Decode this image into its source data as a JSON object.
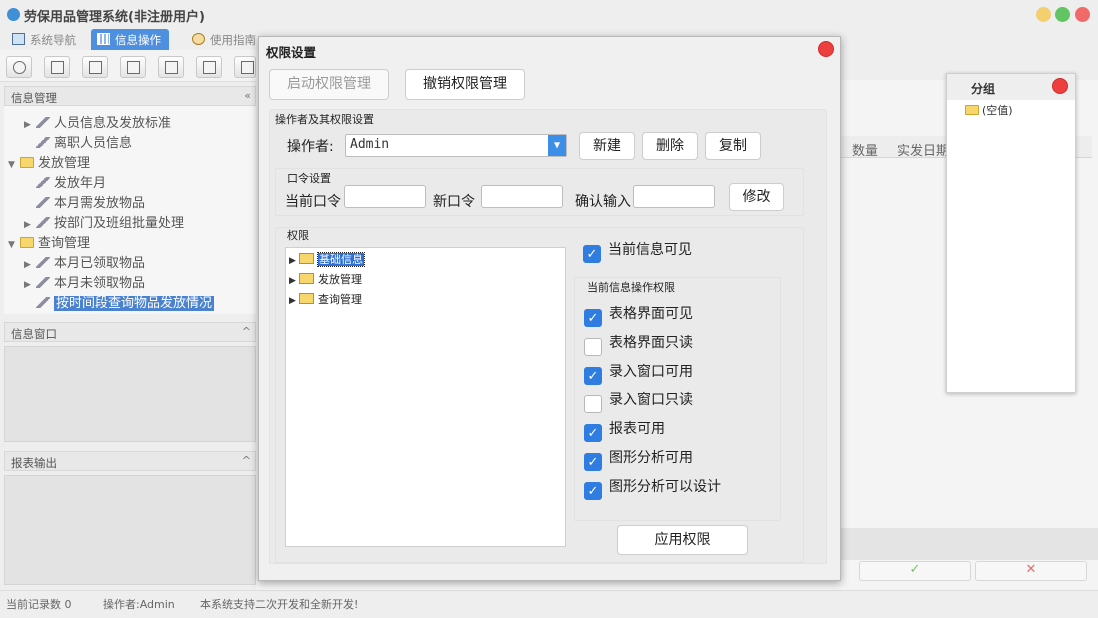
{
  "app": {
    "title": "劳保用品管理系统(非注册用户)"
  },
  "tabs": [
    {
      "label": "系统导航"
    },
    {
      "label": "信息操作"
    },
    {
      "label": "使用指南"
    }
  ],
  "left": {
    "panel_title": "信息管理",
    "tree": [
      {
        "label": "人员信息及发放标准"
      },
      {
        "label": "离职人员信息"
      },
      {
        "label": "发放管理"
      },
      {
        "label": "发放年月"
      },
      {
        "label": "本月需发放物品"
      },
      {
        "label": "按部门及班组批量处理"
      },
      {
        "label": "查询管理"
      },
      {
        "label": "本月已领取物品"
      },
      {
        "label": "本月未领取物品"
      },
      {
        "label": "按时间段查询物品发放情况"
      }
    ],
    "info_window_title": "信息窗口",
    "report_title": "报表输出"
  },
  "grid": {
    "headers": [
      "数量",
      "实发日期"
    ]
  },
  "bottom": {
    "ok_symbol": "✓",
    "cancel_symbol": "✕"
  },
  "status": {
    "records": "当前记录数 0",
    "operator": "操作者:Admin",
    "note": "本系统支持二次开发和全新开发!"
  },
  "group_panel": {
    "title": "分组",
    "item": "(空值)"
  },
  "dialog": {
    "title": "权限设置",
    "btn_start": "启动权限管理",
    "btn_revoke": "撤销权限管理",
    "operator_section": "操作者及其权限设置",
    "operator_label": "操作者:",
    "operator_value": "Admin",
    "btn_new": "新建",
    "btn_delete": "删除",
    "btn_copy": "复制",
    "password_section": "口令设置",
    "current_pwd": "当前口令",
    "new_pwd": "新口令",
    "confirm_pwd": "确认输入",
    "btn_modify": "修改",
    "perm_section": "权限",
    "perm_tree": [
      {
        "label": "基础信息"
      },
      {
        "label": "发放管理"
      },
      {
        "label": "查询管理"
      }
    ],
    "current_visible": "当前信息可见",
    "ops_section": "当前信息操作权限",
    "ops": [
      {
        "label": "表格界面可见",
        "checked": true
      },
      {
        "label": "表格界面只读",
        "checked": false
      },
      {
        "label": "录入窗口可用",
        "checked": true
      },
      {
        "label": "录入窗口只读",
        "checked": false
      },
      {
        "label": "报表可用",
        "checked": true
      },
      {
        "label": "图形分析可用",
        "checked": true
      },
      {
        "label": "图形分析可以设计",
        "checked": true
      }
    ],
    "btn_apply": "应用权限"
  },
  "colors": {
    "accent": "#2f7de0",
    "close": "#ee3f3f",
    "folder": "#f7d76c"
  }
}
